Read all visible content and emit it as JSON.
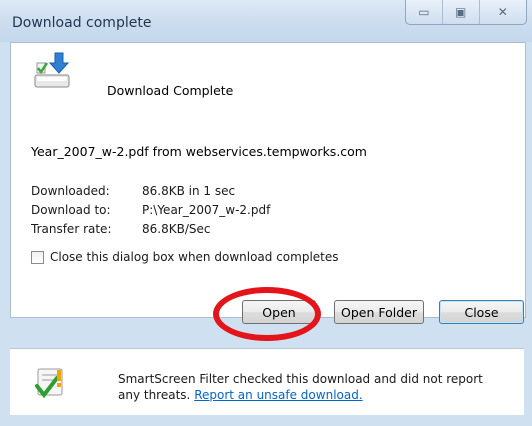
{
  "window": {
    "title": "Download complete",
    "minimize_glyph": "▭",
    "maximize_glyph": "▣",
    "close_glyph": "✕"
  },
  "main": {
    "heading": "Download Complete",
    "file_line": "Year_2007_w-2.pdf from webservices.tempworks.com",
    "info": [
      {
        "label": "Downloaded:",
        "value": "86.8KB in 1 sec"
      },
      {
        "label": "Download to:",
        "value": "P:\\Year_2007_w-2.pdf"
      },
      {
        "label": "Transfer rate:",
        "value": "86.8KB/Sec"
      }
    ],
    "close_when_done": {
      "label": "Close this dialog box when download completes",
      "checked": false
    }
  },
  "buttons": {
    "open": "Open",
    "open_folder": "Open Folder",
    "close": "Close"
  },
  "smartscreen": {
    "text": "SmartScreen Filter checked this download and did not report any threats.",
    "link": "Report an unsafe download."
  },
  "colors": {
    "annotation_red": "#e4141b",
    "link_blue": "#0066cc"
  }
}
